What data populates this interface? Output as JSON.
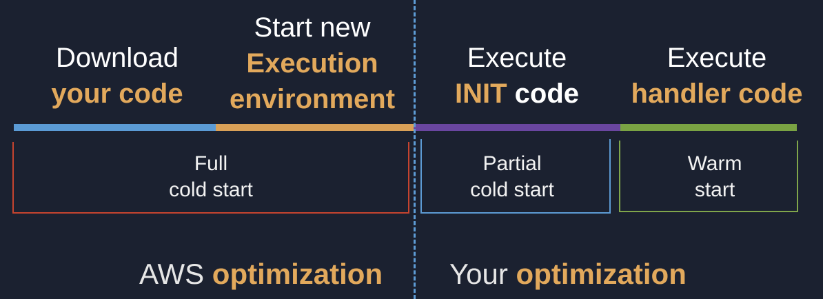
{
  "phases": [
    {
      "line1": "Download",
      "line2": "your code",
      "color": "#5b9bd5"
    },
    {
      "line1": "Start new",
      "line2": "Execution",
      "line3": "environment",
      "color": "#d9a057"
    },
    {
      "line1": "Execute",
      "line2a": "INIT",
      "line2b": "code",
      "color": "#6a46a0"
    },
    {
      "line1": "Execute",
      "line2": "handler code",
      "color": "#7aa343"
    }
  ],
  "brackets": [
    {
      "line1": "Full",
      "line2": "cold start",
      "color": "#c6442f"
    },
    {
      "line1": "Partial",
      "line2": "cold start",
      "color": "#5d9bd4"
    },
    {
      "line1": "Warm",
      "line2": "start",
      "color": "#80a64b"
    }
  ],
  "optimization": {
    "left_prefix": "AWS",
    "left_suffix": "optimization",
    "right_prefix": "Your",
    "right_suffix": "optimization"
  },
  "colors": {
    "background": "#1b2130",
    "accent": "#e2a95c",
    "divider": "#5d9bd4"
  }
}
